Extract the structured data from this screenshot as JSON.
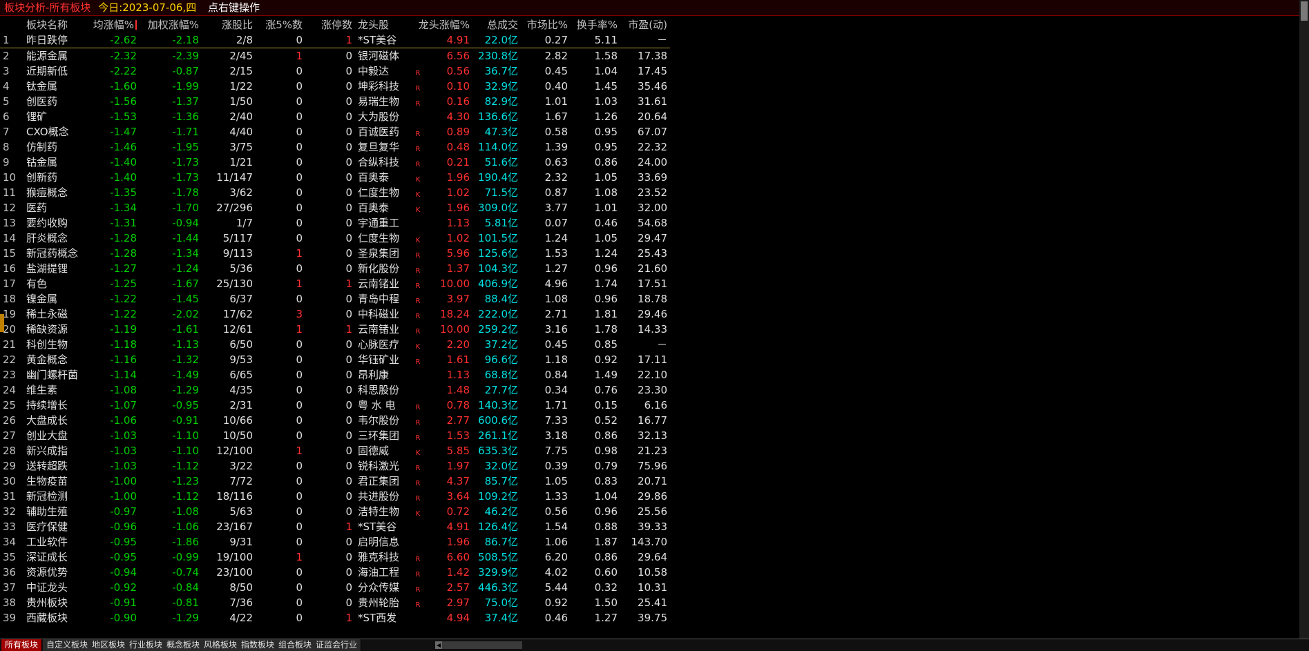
{
  "title": {
    "main": "板块分析-所有板块",
    "today": "今日:2023-07-06,四",
    "hint": "点右键操作"
  },
  "columns": {
    "no": "",
    "name": "板块名称",
    "avg": "均涨幅%",
    "weighted": "加权涨幅%",
    "ratio": "涨股比",
    "up5": "涨5%数",
    "limit_up": "涨停数",
    "leader": "龙头股",
    "leader_chg": "龙头涨幅%",
    "amount": "总成交",
    "market": "市场比%",
    "turnover": "换手率%",
    "pe": "市盈(动)"
  },
  "rows": [
    {
      "no": "1",
      "name": "昨日跌停",
      "avg": "-2.62",
      "weighted": "-2.18",
      "ratio": "2/8",
      "up5": "0",
      "limit_up": "1",
      "leader": "*ST美谷",
      "flag": "",
      "leader_chg": "4.91",
      "amount": "22.0亿",
      "market": "0.27",
      "turnover": "5.11",
      "pe": "－"
    },
    {
      "no": "2",
      "name": "能源金属",
      "avg": "-2.32",
      "weighted": "-2.39",
      "ratio": "2/45",
      "up5": "1",
      "limit_up": "0",
      "leader": "银河磁体",
      "flag": "",
      "leader_chg": "6.56",
      "amount": "230.8亿",
      "market": "2.82",
      "turnover": "1.58",
      "pe": "17.38"
    },
    {
      "no": "3",
      "name": "近期新低",
      "avg": "-2.22",
      "weighted": "-0.87",
      "ratio": "2/15",
      "up5": "0",
      "limit_up": "0",
      "leader": "中毅达",
      "flag": "R",
      "leader_chg": "0.56",
      "amount": "36.7亿",
      "market": "0.45",
      "turnover": "1.04",
      "pe": "17.45"
    },
    {
      "no": "4",
      "name": "钛金属",
      "avg": "-1.60",
      "weighted": "-1.99",
      "ratio": "1/22",
      "up5": "0",
      "limit_up": "0",
      "leader": "坤彩科技",
      "flag": "R",
      "leader_chg": "0.10",
      "amount": "32.9亿",
      "market": "0.40",
      "turnover": "1.45",
      "pe": "35.46"
    },
    {
      "no": "5",
      "name": "创医药",
      "avg": "-1.56",
      "weighted": "-1.37",
      "ratio": "1/50",
      "up5": "0",
      "limit_up": "0",
      "leader": "易瑞生物",
      "flag": "R",
      "leader_chg": "0.16",
      "amount": "82.9亿",
      "market": "1.01",
      "turnover": "1.03",
      "pe": "31.61"
    },
    {
      "no": "6",
      "name": "锂矿",
      "avg": "-1.53",
      "weighted": "-1.36",
      "ratio": "2/40",
      "up5": "0",
      "limit_up": "0",
      "leader": "大为股份",
      "flag": "",
      "leader_chg": "4.30",
      "amount": "136.6亿",
      "market": "1.67",
      "turnover": "1.26",
      "pe": "20.64"
    },
    {
      "no": "7",
      "name": "CXO概念",
      "avg": "-1.47",
      "weighted": "-1.71",
      "ratio": "4/40",
      "up5": "0",
      "limit_up": "0",
      "leader": "百诚医药",
      "flag": "R",
      "leader_chg": "0.89",
      "amount": "47.3亿",
      "market": "0.58",
      "turnover": "0.95",
      "pe": "67.07"
    },
    {
      "no": "8",
      "name": "仿制药",
      "avg": "-1.46",
      "weighted": "-1.95",
      "ratio": "3/75",
      "up5": "0",
      "limit_up": "0",
      "leader": "复旦复华",
      "flag": "R",
      "leader_chg": "0.48",
      "amount": "114.0亿",
      "market": "1.39",
      "turnover": "0.95",
      "pe": "22.32"
    },
    {
      "no": "9",
      "name": "钴金属",
      "avg": "-1.40",
      "weighted": "-1.73",
      "ratio": "1/21",
      "up5": "0",
      "limit_up": "0",
      "leader": "合纵科技",
      "flag": "R",
      "leader_chg": "0.21",
      "amount": "51.6亿",
      "market": "0.63",
      "turnover": "0.86",
      "pe": "24.00"
    },
    {
      "no": "10",
      "name": "创新药",
      "avg": "-1.40",
      "weighted": "-1.73",
      "ratio": "11/147",
      "up5": "0",
      "limit_up": "0",
      "leader": "百奥泰",
      "flag": "K",
      "leader_chg": "1.96",
      "amount": "190.4亿",
      "market": "2.32",
      "turnover": "1.05",
      "pe": "33.69"
    },
    {
      "no": "11",
      "name": "猴痘概念",
      "avg": "-1.35",
      "weighted": "-1.78",
      "ratio": "3/62",
      "up5": "0",
      "limit_up": "0",
      "leader": "仁度生物",
      "flag": "K",
      "leader_chg": "1.02",
      "amount": "71.5亿",
      "market": "0.87",
      "turnover": "1.08",
      "pe": "23.52"
    },
    {
      "no": "12",
      "name": "医药",
      "avg": "-1.34",
      "weighted": "-1.70",
      "ratio": "27/296",
      "up5": "0",
      "limit_up": "0",
      "leader": "百奥泰",
      "flag": "K",
      "leader_chg": "1.96",
      "amount": "309.0亿",
      "market": "3.77",
      "turnover": "1.01",
      "pe": "32.00"
    },
    {
      "no": "13",
      "name": "要约收购",
      "avg": "-1.31",
      "weighted": "-0.94",
      "ratio": "1/7",
      "up5": "0",
      "limit_up": "0",
      "leader": "宇通重工",
      "flag": "",
      "leader_chg": "1.13",
      "amount": "5.81亿",
      "market": "0.07",
      "turnover": "0.46",
      "pe": "54.68"
    },
    {
      "no": "14",
      "name": "肝炎概念",
      "avg": "-1.28",
      "weighted": "-1.44",
      "ratio": "5/117",
      "up5": "0",
      "limit_up": "0",
      "leader": "仁度生物",
      "flag": "K",
      "leader_chg": "1.02",
      "amount": "101.5亿",
      "market": "1.24",
      "turnover": "1.05",
      "pe": "29.47"
    },
    {
      "no": "15",
      "name": "新冠药概念",
      "avg": "-1.28",
      "weighted": "-1.34",
      "ratio": "9/113",
      "up5": "1",
      "limit_up": "0",
      "leader": "圣泉集团",
      "flag": "R",
      "leader_chg": "5.96",
      "amount": "125.6亿",
      "market": "1.53",
      "turnover": "1.24",
      "pe": "25.43"
    },
    {
      "no": "16",
      "name": "盐湖提锂",
      "avg": "-1.27",
      "weighted": "-1.24",
      "ratio": "5/36",
      "up5": "0",
      "limit_up": "0",
      "leader": "新化股份",
      "flag": "R",
      "leader_chg": "1.37",
      "amount": "104.3亿",
      "market": "1.27",
      "turnover": "0.96",
      "pe": "21.60"
    },
    {
      "no": "17",
      "name": "有色",
      "avg": "-1.25",
      "weighted": "-1.67",
      "ratio": "25/130",
      "up5": "1",
      "limit_up": "1",
      "leader": "云南锗业",
      "flag": "R",
      "leader_chg": "10.00",
      "amount": "406.9亿",
      "market": "4.96",
      "turnover": "1.74",
      "pe": "17.51"
    },
    {
      "no": "18",
      "name": "镍金属",
      "avg": "-1.22",
      "weighted": "-1.45",
      "ratio": "6/37",
      "up5": "0",
      "limit_up": "0",
      "leader": "青岛中程",
      "flag": "R",
      "leader_chg": "3.97",
      "amount": "88.4亿",
      "market": "1.08",
      "turnover": "0.96",
      "pe": "18.78"
    },
    {
      "no": "19",
      "name": "稀土永磁",
      "avg": "-1.22",
      "weighted": "-2.02",
      "ratio": "17/62",
      "up5": "3",
      "limit_up": "0",
      "leader": "中科磁业",
      "flag": "R",
      "leader_chg": "18.24",
      "amount": "222.0亿",
      "market": "2.71",
      "turnover": "1.81",
      "pe": "29.46"
    },
    {
      "no": "20",
      "name": "稀缺资源",
      "avg": "-1.19",
      "weighted": "-1.61",
      "ratio": "12/61",
      "up5": "1",
      "limit_up": "1",
      "leader": "云南锗业",
      "flag": "R",
      "leader_chg": "10.00",
      "amount": "259.2亿",
      "market": "3.16",
      "turnover": "1.78",
      "pe": "14.33"
    },
    {
      "no": "21",
      "name": "科创生物",
      "avg": "-1.18",
      "weighted": "-1.13",
      "ratio": "6/50",
      "up5": "0",
      "limit_up": "0",
      "leader": "心脉医疗",
      "flag": "K",
      "leader_chg": "2.20",
      "amount": "37.2亿",
      "market": "0.45",
      "turnover": "0.85",
      "pe": "－"
    },
    {
      "no": "22",
      "name": "黄金概念",
      "avg": "-1.16",
      "weighted": "-1.32",
      "ratio": "9/53",
      "up5": "0",
      "limit_up": "0",
      "leader": "华钰矿业",
      "flag": "R",
      "leader_chg": "1.61",
      "amount": "96.6亿",
      "market": "1.18",
      "turnover": "0.92",
      "pe": "17.11"
    },
    {
      "no": "23",
      "name": "幽门螺杆菌",
      "avg": "-1.14",
      "weighted": "-1.49",
      "ratio": "6/65",
      "up5": "0",
      "limit_up": "0",
      "leader": "昂利康",
      "flag": "",
      "leader_chg": "1.13",
      "amount": "68.8亿",
      "market": "0.84",
      "turnover": "1.49",
      "pe": "22.10"
    },
    {
      "no": "24",
      "name": "维生素",
      "avg": "-1.08",
      "weighted": "-1.29",
      "ratio": "4/35",
      "up5": "0",
      "limit_up": "0",
      "leader": "科思股份",
      "flag": "",
      "leader_chg": "1.48",
      "amount": "27.7亿",
      "market": "0.34",
      "turnover": "0.76",
      "pe": "23.30"
    },
    {
      "no": "25",
      "name": "持续增长",
      "avg": "-1.07",
      "weighted": "-0.95",
      "ratio": "2/31",
      "up5": "0",
      "limit_up": "0",
      "leader": "粤 水 电",
      "flag": "R",
      "leader_chg": "0.78",
      "amount": "140.3亿",
      "market": "1.71",
      "turnover": "0.15",
      "pe": "6.16"
    },
    {
      "no": "26",
      "name": "大盘成长",
      "avg": "-1.06",
      "weighted": "-0.91",
      "ratio": "10/66",
      "up5": "0",
      "limit_up": "0",
      "leader": "韦尔股份",
      "flag": "R",
      "leader_chg": "2.77",
      "amount": "600.6亿",
      "market": "7.33",
      "turnover": "0.52",
      "pe": "16.77"
    },
    {
      "no": "27",
      "name": "创业大盘",
      "avg": "-1.03",
      "weighted": "-1.10",
      "ratio": "10/50",
      "up5": "0",
      "limit_up": "0",
      "leader": "三环集团",
      "flag": "R",
      "leader_chg": "1.53",
      "amount": "261.1亿",
      "market": "3.18",
      "turnover": "0.86",
      "pe": "32.13"
    },
    {
      "no": "28",
      "name": "新兴成指",
      "avg": "-1.03",
      "weighted": "-1.10",
      "ratio": "12/100",
      "up5": "1",
      "limit_up": "0",
      "leader": "固德威",
      "flag": "K",
      "leader_chg": "5.85",
      "amount": "635.3亿",
      "market": "7.75",
      "turnover": "0.98",
      "pe": "21.23"
    },
    {
      "no": "29",
      "name": "送转超跌",
      "avg": "-1.03",
      "weighted": "-1.12",
      "ratio": "3/22",
      "up5": "0",
      "limit_up": "0",
      "leader": "锐科激光",
      "flag": "R",
      "leader_chg": "1.97",
      "amount": "32.0亿",
      "market": "0.39",
      "turnover": "0.79",
      "pe": "75.96"
    },
    {
      "no": "30",
      "name": "生物疫苗",
      "avg": "-1.00",
      "weighted": "-1.23",
      "ratio": "7/72",
      "up5": "0",
      "limit_up": "0",
      "leader": "君正集团",
      "flag": "R",
      "leader_chg": "4.37",
      "amount": "85.7亿",
      "market": "1.05",
      "turnover": "0.83",
      "pe": "20.71"
    },
    {
      "no": "31",
      "name": "新冠检测",
      "avg": "-1.00",
      "weighted": "-1.12",
      "ratio": "18/116",
      "up5": "0",
      "limit_up": "0",
      "leader": "共进股份",
      "flag": "R",
      "leader_chg": "3.64",
      "amount": "109.2亿",
      "market": "1.33",
      "turnover": "1.04",
      "pe": "29.86"
    },
    {
      "no": "32",
      "name": "辅助生殖",
      "avg": "-0.97",
      "weighted": "-1.08",
      "ratio": "5/63",
      "up5": "0",
      "limit_up": "0",
      "leader": "洁特生物",
      "flag": "K",
      "leader_chg": "0.72",
      "amount": "46.2亿",
      "market": "0.56",
      "turnover": "0.96",
      "pe": "25.56"
    },
    {
      "no": "33",
      "name": "医疗保健",
      "avg": "-0.96",
      "weighted": "-1.06",
      "ratio": "23/167",
      "up5": "0",
      "limit_up": "1",
      "leader": "*ST美谷",
      "flag": "",
      "leader_chg": "4.91",
      "amount": "126.4亿",
      "market": "1.54",
      "turnover": "0.88",
      "pe": "39.33"
    },
    {
      "no": "34",
      "name": "工业软件",
      "avg": "-0.95",
      "weighted": "-1.86",
      "ratio": "9/31",
      "up5": "0",
      "limit_up": "0",
      "leader": "启明信息",
      "flag": "",
      "leader_chg": "1.96",
      "amount": "86.7亿",
      "market": "1.06",
      "turnover": "1.87",
      "pe": "143.70"
    },
    {
      "no": "35",
      "name": "深证成长",
      "avg": "-0.95",
      "weighted": "-0.99",
      "ratio": "19/100",
      "up5": "1",
      "limit_up": "0",
      "leader": "雅克科技",
      "flag": "R",
      "leader_chg": "6.60",
      "amount": "508.5亿",
      "market": "6.20",
      "turnover": "0.86",
      "pe": "29.64"
    },
    {
      "no": "36",
      "name": "资源优势",
      "avg": "-0.94",
      "weighted": "-0.74",
      "ratio": "23/100",
      "up5": "0",
      "limit_up": "0",
      "leader": "海油工程",
      "flag": "R",
      "leader_chg": "1.42",
      "amount": "329.9亿",
      "market": "4.02",
      "turnover": "0.60",
      "pe": "10.58"
    },
    {
      "no": "37",
      "name": "中证龙头",
      "avg": "-0.92",
      "weighted": "-0.84",
      "ratio": "8/50",
      "up5": "0",
      "limit_up": "0",
      "leader": "分众传媒",
      "flag": "R",
      "leader_chg": "2.57",
      "amount": "446.3亿",
      "market": "5.44",
      "turnover": "0.32",
      "pe": "10.31"
    },
    {
      "no": "38",
      "name": "贵州板块",
      "avg": "-0.91",
      "weighted": "-0.81",
      "ratio": "7/36",
      "up5": "0",
      "limit_up": "0",
      "leader": "贵州轮胎",
      "flag": "R",
      "leader_chg": "2.97",
      "amount": "75.0亿",
      "market": "0.92",
      "turnover": "1.50",
      "pe": "25.41"
    },
    {
      "no": "39",
      "name": "西藏板块",
      "avg": "-0.90",
      "weighted": "-1.29",
      "ratio": "4/22",
      "up5": "0",
      "limit_up": "1",
      "leader": "*ST西发",
      "flag": "",
      "leader_chg": "4.94",
      "amount": "37.4亿",
      "market": "0.46",
      "turnover": "1.27",
      "pe": "39.75"
    }
  ],
  "tabs": [
    {
      "label": "所有板块",
      "active": true
    },
    {
      "label": "自定义板块",
      "active": false
    },
    {
      "label": "地区板块",
      "active": false
    },
    {
      "label": "行业板块",
      "active": false
    },
    {
      "label": "概念板块",
      "active": false
    },
    {
      "label": "风格板块",
      "active": false
    },
    {
      "label": "指数板块",
      "active": false
    },
    {
      "label": "组合板块",
      "active": false
    },
    {
      "label": "证监会行业",
      "active": false
    }
  ],
  "colors": {
    "up": "#ff3030",
    "down": "#00d000",
    "amount": "#00e0e0",
    "title_accent": "#ff3030",
    "date_accent": "#ffd200"
  }
}
